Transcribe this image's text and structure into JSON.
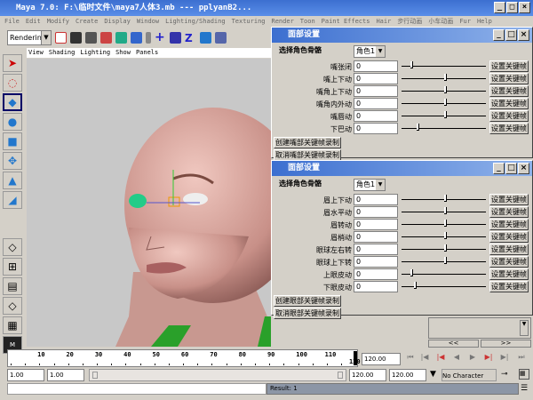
{
  "window": {
    "title": "Maya 7.0: F:\\临时文件\\maya7人体3.mb   ---   pplyanB2..."
  },
  "menu": [
    "File",
    "Edit",
    "Modify",
    "Create",
    "Display",
    "Window",
    "Lighting/Shading",
    "Texturing",
    "Render",
    "Toon",
    "Paint Effects",
    "Hair",
    "步行动画",
    "小车动画",
    "Fur",
    "Help"
  ],
  "toolbar": {
    "menu_set": "Rendering"
  },
  "panel_menu": [
    "View",
    "Shading",
    "Lighting",
    "Show",
    "Panels"
  ],
  "mouth_dialog": {
    "title": "面部设置",
    "select_label": "选择角色骨骼",
    "select_value": "角色1",
    "key_label": "设置关键帧",
    "rows": [
      {
        "label": "嘴张闭",
        "value": "0",
        "slider": 0.1
      },
      {
        "label": "嘴上下动",
        "value": "0",
        "slider": 0.5
      },
      {
        "label": "嘴角上下动",
        "value": "0",
        "slider": 0.5
      },
      {
        "label": "嘴角内外动",
        "value": "0",
        "slider": 0.5
      },
      {
        "label": "嘴唇动",
        "value": "0",
        "slider": 0.5
      },
      {
        "label": "下巴动",
        "value": "0",
        "slider": 0.18
      }
    ],
    "create_btn": "创建嘴部关键帧录制",
    "cancel_btn": "取消嘴部关键帧录制"
  },
  "eye_dialog": {
    "title": "面部设置",
    "select_label": "选择角色骨骼",
    "select_value": "角色1",
    "key_label": "设置关键帧",
    "rows": [
      {
        "label": "眉上下动",
        "value": "0",
        "slider": 0.5
      },
      {
        "label": "眉水平动",
        "value": "0",
        "slider": 0.5
      },
      {
        "label": "眉转动",
        "value": "0",
        "slider": 0.5
      },
      {
        "label": "眉梢动",
        "value": "0",
        "slider": 0.5
      },
      {
        "label": "眼球左右转",
        "value": "0",
        "slider": 0.5
      },
      {
        "label": "眼球上下转",
        "value": "0",
        "slider": 0.5
      },
      {
        "label": "上眼皮动",
        "value": "0",
        "slider": 0.1
      },
      {
        "label": "下眼皮动",
        "value": "0",
        "slider": 0.15
      }
    ],
    "create_btn": "创建眼部关键帧录制",
    "cancel_btn": "取消眼部关键帧录制"
  },
  "side": {
    "prev": "<<",
    "next": ">>"
  },
  "timeline": {
    "ticks": [
      "10",
      "20",
      "30",
      "40",
      "50",
      "60",
      "70",
      "80",
      "90",
      "100",
      "110"
    ],
    "end_label": "120",
    "current": "120.00"
  },
  "range": {
    "start": "1.00",
    "playback_start": "1.00",
    "playback_end": "120.00",
    "end": "120.00",
    "character_set": "No Character Set"
  },
  "command": {
    "result": "Result: 1"
  }
}
